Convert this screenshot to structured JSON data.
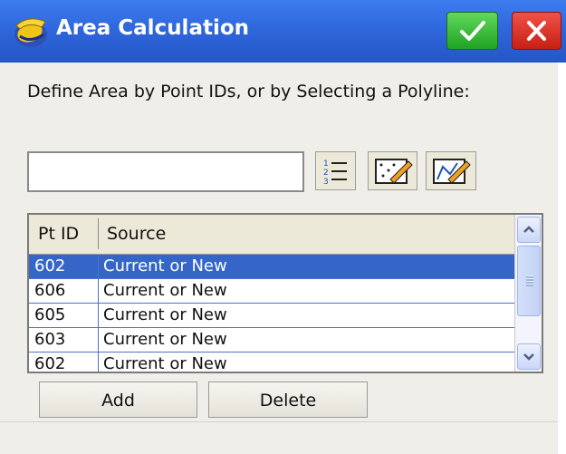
{
  "window": {
    "title": "Area Calculation",
    "ok_icon": "checkmark-icon",
    "close_icon": "close-icon"
  },
  "prompt": "Define Area by Point IDs, or by Selecting a Polyline:",
  "point_input": {
    "value": "",
    "placeholder": ""
  },
  "tool_buttons": [
    "list-icon",
    "map-select-icon",
    "polyline-select-icon"
  ],
  "table": {
    "columns": [
      "Pt ID",
      "Source"
    ],
    "rows": [
      {
        "pt_id": "602",
        "source": "Current or New",
        "selected": true
      },
      {
        "pt_id": "606",
        "source": "Current or New"
      },
      {
        "pt_id": "605",
        "source": "Current or New"
      },
      {
        "pt_id": "603",
        "source": "Current or New"
      },
      {
        "pt_id": "602",
        "source": "Current or New"
      }
    ]
  },
  "buttons": {
    "add": "Add",
    "delete": "Delete"
  },
  "colors": {
    "title_bar": "#2f67dc",
    "selection": "#3566c7",
    "ok": "#1fa322",
    "close": "#c81f14"
  }
}
